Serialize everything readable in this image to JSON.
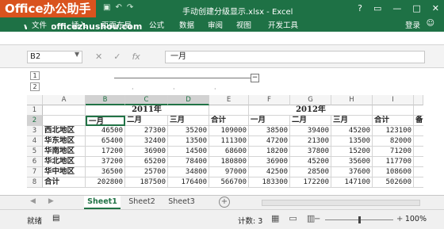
{
  "watermark": {
    "logo": "Office办公助手",
    "site": "www.officezhushou.com"
  },
  "window": {
    "title": "手动创建分级显示.xlsx - Excel",
    "controls": [
      "?",
      "▭",
      "—",
      "□",
      "✕"
    ]
  },
  "ribbon": {
    "tabs": [
      "文件",
      "插入",
      "页面布局",
      "公式",
      "数据",
      "审阅",
      "视图",
      "开发工具"
    ],
    "login": "登录"
  },
  "formula_bar": {
    "name_box": "B2",
    "content": "一月"
  },
  "outline": {
    "levels": [
      "1",
      "2"
    ],
    "collapse_symbol": "−"
  },
  "grid": {
    "columns": [
      "A",
      "B",
      "C",
      "D",
      "E",
      "F",
      "G",
      "H",
      "I"
    ],
    "rows": [
      [
        "",
        "",
        "2011年",
        "",
        "",
        "",
        "2012年",
        "",
        ""
      ],
      [
        "",
        "一月",
        "二月",
        "三月",
        "合计",
        "一月",
        "二月",
        "三月",
        "合计"
      ],
      [
        "西北地区",
        "46500",
        "27300",
        "35200",
        "109000",
        "38500",
        "39400",
        "45200",
        "123100"
      ],
      [
        "华东地区",
        "65400",
        "32400",
        "13500",
        "111300",
        "47200",
        "21300",
        "13500",
        "82000"
      ],
      [
        "华南地区",
        "17200",
        "36900",
        "14500",
        "68600",
        "18200",
        "37800",
        "15200",
        "71200"
      ],
      [
        "华北地区",
        "37200",
        "65200",
        "78400",
        "180800",
        "36900",
        "45200",
        "35600",
        "117700"
      ],
      [
        "华中地区",
        "36500",
        "25700",
        "34800",
        "97000",
        "42500",
        "28500",
        "37600",
        "108600"
      ],
      [
        "合计",
        "202800",
        "187500",
        "176400",
        "566700",
        "183300",
        "172200",
        "147100",
        "502600"
      ]
    ],
    "overflow_j2": "备"
  },
  "sheets": {
    "tabs": [
      "Sheet1",
      "Sheet2",
      "Sheet3"
    ],
    "active": "Sheet1"
  },
  "status": {
    "ready": "就绪",
    "count": "计数: 3",
    "zoom": "100%"
  }
}
